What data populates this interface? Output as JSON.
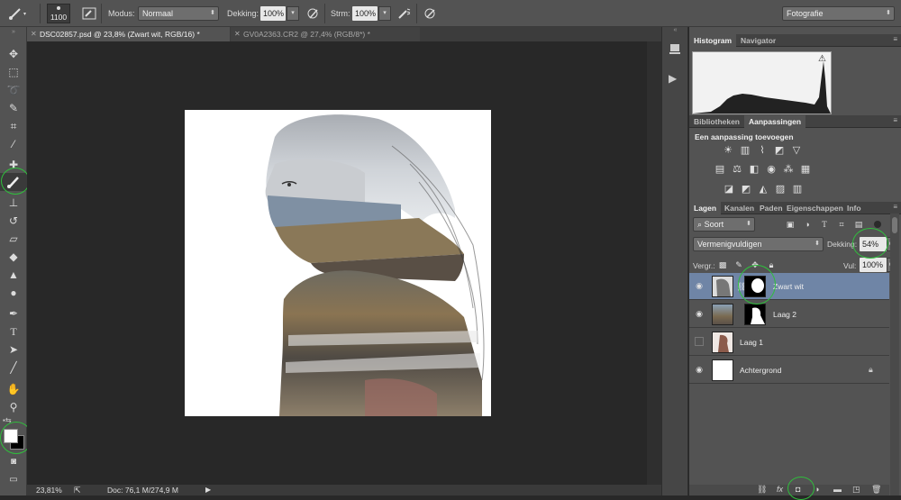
{
  "options_bar": {
    "brush_size": "1100",
    "mode_label": "Modus:",
    "mode_value": "Normaal",
    "opacity_label": "Dekking:",
    "opacity_value": "100%",
    "flow_label": "Strm:",
    "flow_value": "100%",
    "workspace_value": "Fotografie"
  },
  "doc_tabs": [
    {
      "label": "DSC02857.psd @ 23,8% (Zwart wit, RGB/16) *",
      "active": true
    },
    {
      "label": "GV0A2363.CR2 @ 27,4% (RGB/8*) *",
      "active": false
    }
  ],
  "status_bar": {
    "zoom": "23,81%",
    "doc_info": "Doc: 76,1 M/274,9 M"
  },
  "panels": {
    "histogram_tabs": [
      "Histogram",
      "Navigator"
    ],
    "histogram_warning": "⚠",
    "adjust_tabs": [
      "Bibliotheken",
      "Aanpassingen"
    ],
    "adjust_title": "Een aanpassing toevoegen",
    "layers_tabs": [
      "Lagen",
      "Kanalen",
      "Paden",
      "Eigenschappen",
      "Info"
    ],
    "layers_filter": "Soort",
    "blend_mode": "Vermenigvuldigen",
    "opacity_label": "Dekking:",
    "opacity_value": "54%",
    "lock_label": "Vergr.:",
    "fill_label": "Vul:",
    "fill_value": "100%",
    "layers": [
      {
        "name": "Zwart wit",
        "visible": true,
        "selected": true
      },
      {
        "name": "Laag 2",
        "visible": true,
        "selected": false
      },
      {
        "name": "Laag 1",
        "visible": false,
        "selected": false
      },
      {
        "name": "Achtergrond",
        "visible": true,
        "selected": false
      }
    ]
  },
  "colors": {
    "accent_selected_layer": "#6f85a6",
    "highlight_ring": "#2fbf3c"
  }
}
